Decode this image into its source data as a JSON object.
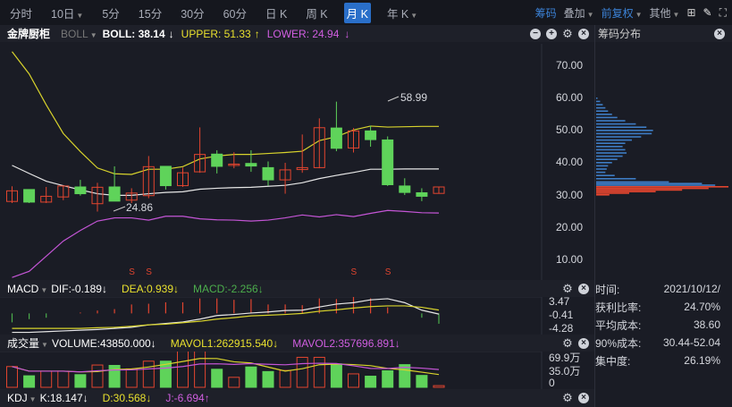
{
  "toolbar": {
    "periods": [
      "分时",
      "10日",
      "5分",
      "15分",
      "30分",
      "60分",
      "日 K",
      "周 K",
      "月 K",
      "年 K"
    ],
    "active": "月 K",
    "chips": "筹码",
    "overlay": "叠加",
    "adjust": "前复权",
    "other": "其他"
  },
  "header": {
    "stock": "金牌厨柜",
    "indicator": "BOLL",
    "boll": "BOLL: 38.14",
    "boll_arrow": "↓",
    "upper": "UPPER: 51.33",
    "upper_arrow": "↑",
    "lower": "LOWER: 24.94",
    "lower_arrow": "↓",
    "chip_title": "筹码分布"
  },
  "price_axis": [
    "70.00",
    "60.00",
    "50.00",
    "40.00",
    "30.00",
    "20.00",
    "10.00"
  ],
  "annotations": {
    "high": "58.99",
    "low": "24.86",
    "signal": "S"
  },
  "macd": {
    "name": "MACD",
    "dif": "DIF:-0.189↓",
    "dea": "DEA:0.939↓",
    "macd": "MACD:-2.256↓",
    "axis": [
      "3.47",
      "-0.41",
      "-4.28"
    ]
  },
  "volume": {
    "name": "成交量",
    "vol": "VOLUME:43850.000↓",
    "mavol1": "MAVOL1:262915.540↓",
    "mavol2": "MAVOL2:357696.891↓",
    "axis": [
      "69.9万",
      "35.0万",
      "0"
    ]
  },
  "kdj": {
    "name": "KDJ",
    "k": "K:18.147↓",
    "d": "D:30.568↓",
    "j": "J:-6.694↑"
  },
  "info": [
    {
      "label": "时间:",
      "value": "2021/10/12/"
    },
    {
      "label": "获利比率:",
      "value": "24.70%"
    },
    {
      "label": "平均成本:",
      "value": "38.60"
    },
    {
      "label": "90%成本:",
      "value": "30.44-52.04"
    },
    {
      "label": "集中度:",
      "value": "26.19%"
    }
  ],
  "colors": {
    "up": "#e2452f",
    "down": "#5fd35a",
    "upper": "#d8d32c",
    "mid": "#e6e6e6",
    "lower": "#c455d6",
    "chip_profit": "#e2452f",
    "chip_loss": "#3e7cc4"
  },
  "chart_data": {
    "type": "candlestick",
    "ohlc": [
      [
        28,
        31.3,
        32.7,
        27.5
      ],
      [
        31.7,
        27.8,
        31.7,
        27.5
      ],
      [
        27.8,
        29.6,
        32.5,
        27.5
      ],
      [
        29.4,
        32.8,
        32.8,
        28.4
      ],
      [
        32.5,
        30.4,
        34.7,
        29.8
      ],
      [
        27.3,
        32.4,
        33.8,
        24.86
      ],
      [
        32.5,
        28.1,
        38.9,
        28.1
      ],
      [
        28.4,
        30.6,
        32.1,
        27.5
      ],
      [
        29.8,
        38.8,
        42.1,
        29
      ],
      [
        38.9,
        32.9,
        38.9,
        31.7
      ],
      [
        32.9,
        36.9,
        38.5,
        32.5
      ],
      [
        37.2,
        42.6,
        51,
        36.9
      ],
      [
        42.7,
        38.9,
        43.9,
        36.7
      ],
      [
        39.2,
        39.6,
        43.3,
        38.3
      ],
      [
        39.8,
        39,
        43.9,
        37.2
      ],
      [
        38.5,
        34.7,
        40.4,
        32.9
      ],
      [
        34.7,
        37.8,
        40,
        30.4
      ],
      [
        37.9,
        38.5,
        48.8,
        36.9
      ],
      [
        38.5,
        50.9,
        53.8,
        38.3
      ],
      [
        50.8,
        44.5,
        58.99,
        43.6
      ],
      [
        44.6,
        49.9,
        50.8,
        43.2
      ],
      [
        49.9,
        47.2,
        51.5,
        45
      ],
      [
        47.1,
        33.2,
        48.2,
        32.8
      ],
      [
        32.8,
        30.8,
        35.2,
        30
      ],
      [
        30.7,
        29.6,
        32.1,
        28.1
      ],
      [
        30.5,
        32.5,
        32.5,
        30.5
      ]
    ],
    "upper": [
      74.5,
      67.6,
      58,
      49.1,
      43.5,
      38.4,
      36.6,
      36.4,
      38,
      38,
      38.8,
      41.2,
      42.1,
      42.6,
      42.6,
      42.9,
      43.2,
      43.6,
      46.9,
      48.1,
      50.2,
      51.4,
      51.1,
      51.2,
      51.3,
      51.3
    ],
    "mid": [
      39.2,
      36.7,
      34.3,
      32.9,
      31.6,
      30.4,
      29.9,
      29.9,
      30.4,
      30.8,
      31,
      31.8,
      32.1,
      32.3,
      32.4,
      32.7,
      33,
      33.8,
      35.1,
      36.1,
      37,
      38,
      38,
      38.1,
      38.1,
      38.1
    ],
    "lower": [
      4.4,
      6.3,
      11,
      15.7,
      19,
      21.9,
      22.9,
      22.9,
      22.2,
      23.4,
      23.4,
      22.6,
      22.3,
      22.2,
      21.9,
      22.2,
      22.9,
      23.8,
      23.2,
      23.9,
      23.3,
      24.3,
      25.2,
      24.9,
      24.5,
      24.4
    ],
    "signals": [
      7,
      8,
      20,
      22
    ],
    "volume_wan": [
      54,
      30,
      42,
      42,
      33,
      58,
      57,
      48,
      68,
      68,
      95,
      96,
      47,
      26,
      53,
      41,
      44,
      78,
      78,
      61,
      35,
      29,
      43,
      59,
      31,
      4.4
    ],
    "macd_hist": [
      -2.5,
      -1.6,
      -1.2,
      0,
      0.25,
      0.8,
      1.2,
      2.5,
      2.7,
      3.1,
      3.1,
      4.2,
      4.2,
      3.8,
      4,
      2.5,
      2.5,
      2.3,
      4.2,
      4,
      4.6,
      4.2,
      1.7,
      0,
      -1.2,
      -2.9
    ],
    "dif": [
      -5.3,
      -5.3,
      -5.1,
      -4.9,
      -4.7,
      -4.5,
      -4.2,
      -3.9,
      -3.2,
      -2.8,
      -2.4,
      -1.6,
      -0.6,
      -0.3,
      0.1,
      0.4,
      0.8,
      0.9,
      1.8,
      2.6,
      3,
      3.8,
      4.1,
      3,
      0.9,
      -0.19
    ],
    "dea": [
      -4.2,
      -4.2,
      -4.2,
      -4.2,
      -4.2,
      -4,
      -3.9,
      -3.6,
      -3.2,
      -3,
      -2.6,
      -2.2,
      -1.6,
      -1.2,
      -0.7,
      -0.5,
      -0.3,
      0,
      0.6,
      1,
      1.5,
      1.9,
      2.1,
      2.1,
      1.7,
      0.94
    ],
    "chips": [
      [
        60,
        0.01
      ],
      [
        59,
        0.03
      ],
      [
        58,
        0.05
      ],
      [
        57,
        0.07
      ],
      [
        56,
        0.09
      ],
      [
        55,
        0.12
      ],
      [
        54,
        0.16
      ],
      [
        53,
        0.22
      ],
      [
        52,
        0.3
      ],
      [
        51,
        0.38
      ],
      [
        50,
        0.43
      ],
      [
        49,
        0.42
      ],
      [
        48,
        0.34
      ],
      [
        47,
        0.27
      ],
      [
        46,
        0.22
      ],
      [
        45,
        0.2
      ],
      [
        44,
        0.22
      ],
      [
        43,
        0.23
      ],
      [
        42,
        0.2
      ],
      [
        41,
        0.16
      ],
      [
        40,
        0.12
      ],
      [
        39,
        0.09
      ],
      [
        38,
        0.08
      ],
      [
        37,
        0.07
      ],
      [
        36,
        0.14
      ],
      [
        35,
        0.3
      ],
      [
        34,
        0.55
      ],
      [
        33.5,
        0.8
      ],
      [
        33,
        0.9
      ],
      [
        32.5,
        1.0
      ],
      [
        32,
        0.85
      ],
      [
        31.5,
        0.65
      ],
      [
        31,
        0.45
      ],
      [
        30.5,
        0.25
      ],
      [
        30,
        0.1
      ]
    ],
    "chip_split": 33
  }
}
